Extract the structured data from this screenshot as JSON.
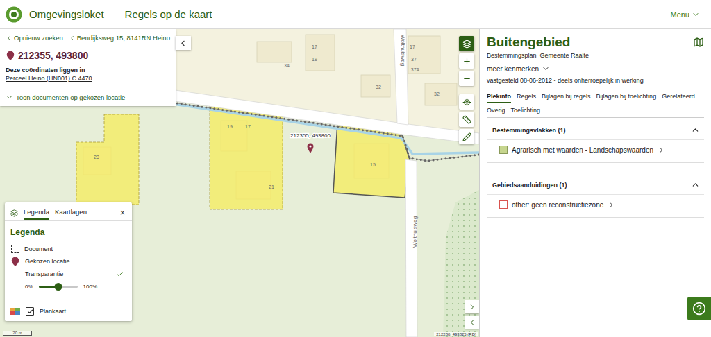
{
  "header": {
    "brand": "Omgevingsloket",
    "title": "Regels op de kaart",
    "menu": {
      "label": "Menu",
      "expanded": false
    }
  },
  "location_card": {
    "links": [
      "Opnieuw zoeken",
      "Bendijksweg 15, 8141RN Heino"
    ],
    "coordinates": "212355, 493800",
    "intro": "Deze coördinaten liggen in",
    "parcel": "Perceel Heino (HN001) C 4470",
    "documents_toggle": {
      "label": "Toon documenten op gekozen locatie",
      "expanded": false
    }
  },
  "map": {
    "pin_label": "212355, 493800",
    "house_numbers": [
      "17",
      "19",
      "34",
      "32",
      "17",
      "37",
      "37A",
      "32",
      "23",
      "19",
      "17",
      "21",
      "15"
    ],
    "streets": [
      "Wolthuisweg",
      "Wolthuisweg"
    ],
    "scale": "20 m",
    "readout": "212280, 493825 (RD)"
  },
  "legend": {
    "tabs": [
      {
        "label": "Legenda",
        "selected": true
      },
      {
        "label": "Kaartlagen",
        "selected": false
      }
    ],
    "close": "×",
    "heading": "Legenda",
    "symbols": [
      {
        "kind": "document",
        "label": "Document"
      },
      {
        "kind": "pin",
        "label": "Gekozen locatie"
      }
    ],
    "transparency": {
      "label": "Transparantie",
      "checked": true,
      "min": "0%",
      "max": "100%",
      "level": 0.5
    },
    "layers": [
      {
        "label": "Plankaart",
        "checked": true
      }
    ]
  },
  "panel": {
    "title": "Buitengebied",
    "type": "Bestemmingsplan",
    "authority": "Gemeente Raalte",
    "more": {
      "label": "meer kenmerken",
      "expanded": false
    },
    "status": "vastgesteld 08-06-2012 - deels onherroepelijk in werking",
    "tabs": [
      {
        "label": "Plekinfo",
        "selected": true
      },
      {
        "label": "Regels",
        "selected": false
      },
      {
        "label": "Bijlagen bij regels",
        "selected": false
      },
      {
        "label": "Bijlagen bij toelichting",
        "selected": false
      },
      {
        "label": "Gerelateerd",
        "selected": false
      },
      {
        "label": "Overig",
        "selected": false
      },
      {
        "label": "Toelichting",
        "selected": false
      }
    ],
    "sections": [
      {
        "title": "Bestemmingsvlakken (1)",
        "expanded": true,
        "items": [
          {
            "label": "Agrarisch met waarden - Landschapswaarden",
            "kind": "fill",
            "color": "#c6d58e"
          }
        ]
      },
      {
        "title": "Gebiedsaanduidingen (1)",
        "expanded": true,
        "items": [
          {
            "label": "other: geen reconstructiezone",
            "kind": "outline",
            "color": "#d9534f"
          }
        ]
      }
    ]
  }
}
